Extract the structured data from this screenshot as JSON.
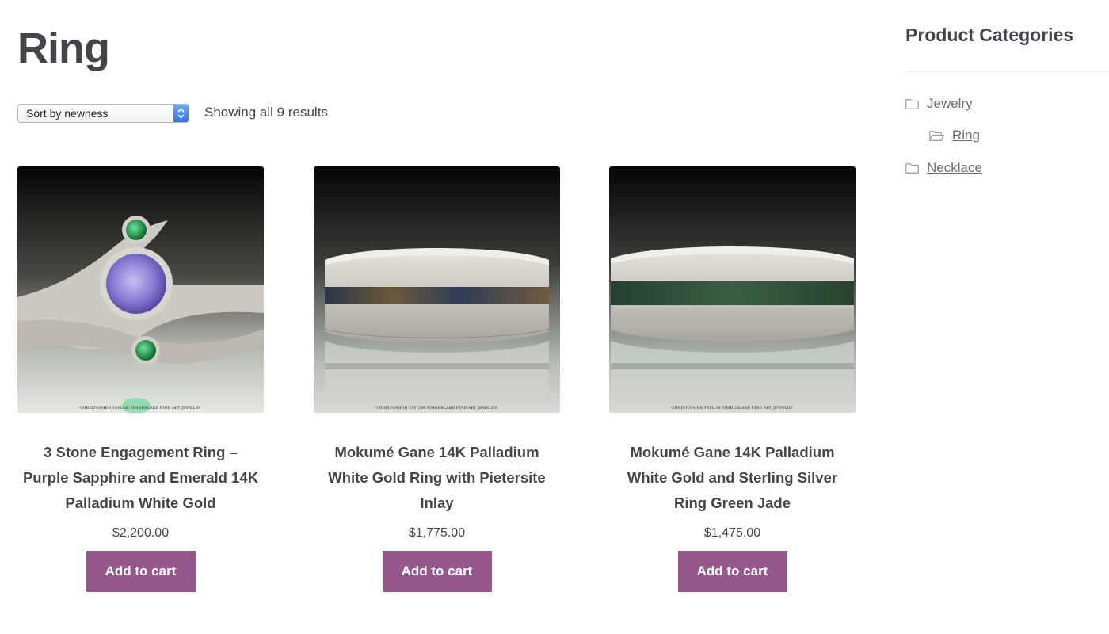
{
  "page": {
    "title": "Ring"
  },
  "toolbar": {
    "sort_label": "Sort by newness",
    "result_count": "Showing all 9 results"
  },
  "products": [
    {
      "title": "3 Stone Engagement Ring – Purple Sapphire and Emerald 14K Palladium White Gold",
      "price": "$2,200.00",
      "button_label": "Add to cart",
      "image_watermark": "CHRISTOPHER TAYLOR TIMBERLAKE   FINE ART JEWELRY"
    },
    {
      "title": "Mokumé Gane 14K Palladium White Gold Ring with Pietersite Inlay",
      "price": "$1,775.00",
      "button_label": "Add to cart",
      "image_watermark": "CHRISTOPHER TAYLOR TIMBERLAKE   FINE ART JEWELRY"
    },
    {
      "title": "Mokumé Gane 14K Palladium White Gold and Sterling Silver Ring Green Jade",
      "price": "$1,475.00",
      "button_label": "Add to cart",
      "image_watermark": "CHRISTOPHER TAYLOR TIMBERLAKE   FINE ART JEWELRY"
    }
  ],
  "sidebar": {
    "widget_title": "Product Categories",
    "categories": [
      {
        "label": "Jewelry",
        "icon": "folder-icon"
      },
      {
        "label": "Ring",
        "icon": "folder-open-icon"
      },
      {
        "label": "Necklace",
        "icon": "folder-icon"
      }
    ]
  },
  "colors": {
    "button_bg": "#96588a",
    "text": "#43454b",
    "link": "#6d6d6d"
  }
}
